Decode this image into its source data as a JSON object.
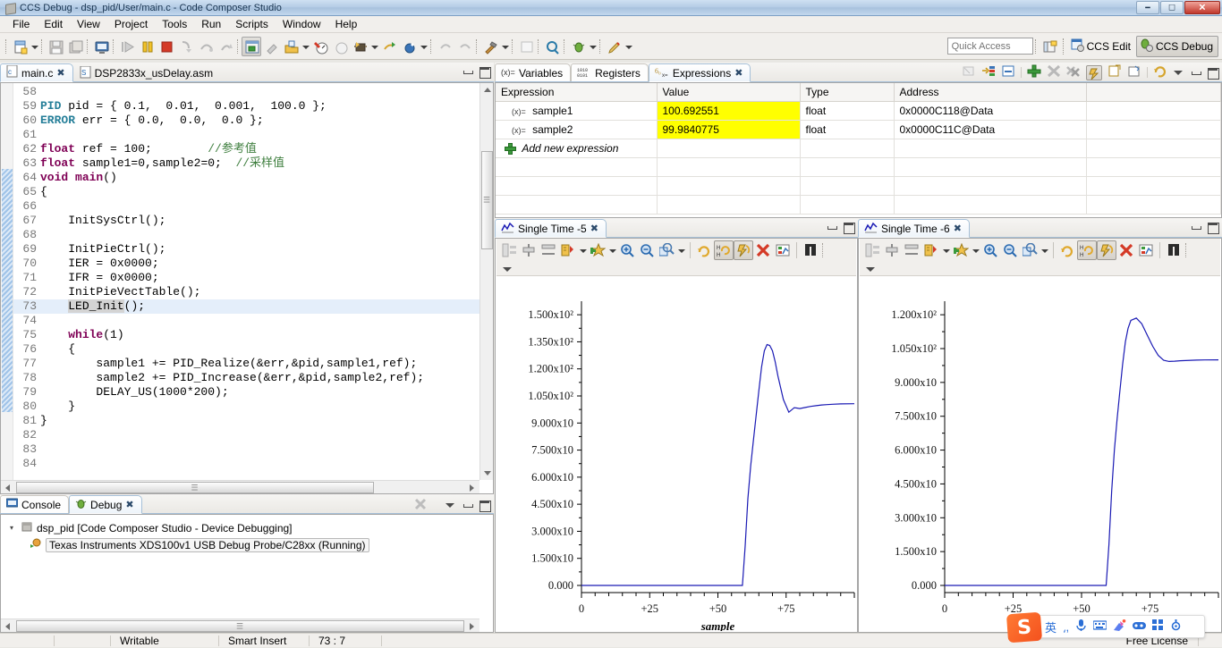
{
  "window": {
    "title": "CCS Debug - dsp_pid/User/main.c - Code Composer Studio",
    "icon": "ccs-app-icon",
    "minimize": "–",
    "restore": "❐",
    "close": "✕"
  },
  "menu": {
    "items": [
      "File",
      "Edit",
      "View",
      "Project",
      "Tools",
      "Run",
      "Scripts",
      "Window",
      "Help"
    ]
  },
  "toolbar": {
    "icons": [
      "new-file-icon",
      "save-icon",
      "save-all-icon",
      "console-icon",
      "resume-icon",
      "suspend-icon",
      "terminate-icon",
      "step-into-icon",
      "step-over-icon",
      "step-return-icon",
      "instruction-stepping-icon",
      "disassembly-icon",
      "load-program-icon",
      "debug-launch-icon",
      "restart-icon",
      "connect-target-icon",
      "run-icon",
      "profile-icon",
      "new-object-icon",
      "undo-icon",
      "redo-icon",
      "build-icon",
      "open-type-icon",
      "search-icon",
      "debug-icon",
      "pin-icon"
    ],
    "quick_access_placeholder": "Quick Access",
    "new_perspective_icon": "open-perspective-icon",
    "perspectives": [
      {
        "label": "CCS Edit",
        "icon": "ccs-edit-icon",
        "active": false
      },
      {
        "label": "CCS Debug",
        "icon": "ccs-debug-icon",
        "active": true
      }
    ]
  },
  "editor": {
    "tabs": [
      {
        "label": "main.c",
        "icon": "c-file-icon",
        "selected": true,
        "closable": true
      },
      {
        "label": "DSP2833x_usDelay.asm",
        "icon": "asm-file-icon",
        "selected": false,
        "closable": false
      }
    ],
    "first_line": 58,
    "highlight_line": 73,
    "lines": [
      {
        "n": 58,
        "text": ""
      },
      {
        "n": 59,
        "html": "<span class='t'>PID</span> pid = { 0.1,  0.01,  0.001,  100.0 };"
      },
      {
        "n": 60,
        "html": "<span class='t'>ERROR</span> err = { 0.0,  0.0,  0.0 };"
      },
      {
        "n": 61,
        "html": ""
      },
      {
        "n": 62,
        "html": "<span class='k'>float</span> ref = 100;        <span class='cm'>//参考值</span>"
      },
      {
        "n": 63,
        "html": "<span class='k'>float</span> sample1=0,sample2=0;  <span class='cm'>//采样值</span>"
      },
      {
        "n": 64,
        "html": "<span class='k'>void</span> <span class='k'>main</span>()"
      },
      {
        "n": 65,
        "html": "{"
      },
      {
        "n": 66,
        "html": ""
      },
      {
        "n": 67,
        "html": "    InitSysCtrl();"
      },
      {
        "n": 68,
        "html": ""
      },
      {
        "n": 69,
        "html": "    InitPieCtrl();"
      },
      {
        "n": 70,
        "html": "    IER = 0x0000;"
      },
      {
        "n": 71,
        "html": "    IFR = 0x0000;"
      },
      {
        "n": 72,
        "html": "    InitPieVectTable();"
      },
      {
        "n": 73,
        "html": "    <span class='sel'>LED_Init</span>();"
      },
      {
        "n": 74,
        "html": ""
      },
      {
        "n": 75,
        "html": "    <span class='k'>while</span>(1)"
      },
      {
        "n": 76,
        "html": "    {"
      },
      {
        "n": 77,
        "html": "        sample1 += PID_Realize(&amp;err,&amp;pid,sample1,ref);"
      },
      {
        "n": 78,
        "html": "        sample2 += PID_Increase(&amp;err,&amp;pid,sample2,ref);"
      },
      {
        "n": 79,
        "html": "        DELAY_US(1000*200);"
      },
      {
        "n": 80,
        "html": "    }"
      },
      {
        "n": 81,
        "html": "}"
      },
      {
        "n": 82,
        "html": ""
      },
      {
        "n": 83,
        "html": ""
      },
      {
        "n": 84,
        "html": ""
      }
    ]
  },
  "debug_view": {
    "tabs": [
      {
        "label": "Console",
        "icon": "console-icon",
        "selected": false
      },
      {
        "label": "Debug",
        "icon": "debug-bug-icon",
        "selected": true,
        "closable": true
      }
    ],
    "toolbar_icons": [
      "remove-all-terminated-icon",
      "view-menu-icon",
      "minimize-icon",
      "maximize-icon"
    ],
    "tree": [
      {
        "level": 0,
        "expanded": true,
        "icon": "launch-config-icon",
        "label": "dsp_pid [Code Composer Studio - Device Debugging]"
      },
      {
        "level": 1,
        "icon": "thread-running-icon",
        "selected": true,
        "label": "Texas Instruments XDS100v1 USB Debug Probe/C28xx (Running)"
      }
    ]
  },
  "expressions": {
    "tabs": [
      {
        "label": "Variables",
        "icon": "variables-icon",
        "selected": false
      },
      {
        "label": "Registers",
        "icon": "registers-icon",
        "selected": false
      },
      {
        "label": "Expressions",
        "icon": "expressions-icon",
        "selected": true,
        "closable": true
      }
    ],
    "toolbar_icons": [
      "cast-to-type-icon",
      "show-type-names-icon",
      "collapse-all-icon",
      "add-expression-icon",
      "remove-icon",
      "remove-all-icon",
      "enable-watch-icon",
      "new-watchpoint-icon",
      "edit-watchpoint-icon",
      "refresh-icon",
      "view-menu-icon",
      "minimize-icon",
      "maximize-icon"
    ],
    "columns": [
      "Expression",
      "Value",
      "Type",
      "Address",
      ""
    ],
    "rows": [
      {
        "expression": "sample1",
        "value": "100.692551",
        "type": "float",
        "address": "0x0000C118@Data",
        "icon": "variable-icon",
        "highlight": true
      },
      {
        "expression": "sample2",
        "value": "99.9840775",
        "type": "float",
        "address": "0x0000C11C@Data",
        "icon": "variable-icon",
        "highlight": true
      }
    ],
    "add_row_label": "Add new expression",
    "highlight_color": "#ffff00"
  },
  "graphs": [
    {
      "tab_label": "Single Time -5",
      "tab_icon": "graph-icon",
      "toolbar_icons": [
        "graph-properties-icon",
        "align-icon",
        "distribute-icon",
        "scale-icon",
        "add-marker-icon",
        "zoom-in-icon",
        "zoom-out-icon",
        "zoom-area-icon",
        "refresh-all-icon",
        "continuous-refresh-h-icon",
        "continuous-refresh-icon",
        "clear-data-icon",
        "export-icon",
        "find-icon"
      ],
      "chart_data": {
        "type": "line",
        "title": "Single Time -5",
        "xlabel": "sample",
        "ylabel": "",
        "series_color": "#1a1ab4",
        "grid": false,
        "legend": "none",
        "ylim": [
          0,
          157.5
        ],
        "xlim": [
          0,
          100
        ],
        "yticks": [
          "0.000",
          "1.500x10",
          "3.000x10",
          "4.500x10",
          "6.000x10",
          "7.500x10",
          "9.000x10",
          "1.050x10²",
          "1.200x10²",
          "1.350x10²",
          "1.500x10²"
        ],
        "ytick_values": [
          0,
          15,
          30,
          45,
          60,
          75,
          90,
          105,
          120,
          135,
          150
        ],
        "xticks": [
          "0",
          "+25",
          "+50",
          "+75"
        ],
        "xtick_values": [
          0,
          25,
          50,
          75
        ],
        "x": [
          0,
          10,
          20,
          30,
          40,
          50,
          55,
          58,
          59,
          60,
          61,
          62,
          63,
          64,
          65,
          66,
          67,
          68,
          69,
          70,
          71,
          72,
          74,
          76,
          78,
          80,
          82,
          84,
          86,
          88,
          90,
          92,
          95,
          100
        ],
        "y": [
          0,
          0,
          0,
          0,
          0,
          0,
          0,
          0,
          0,
          22,
          48,
          66,
          80,
          94,
          108,
          121,
          130,
          133.5,
          133,
          130,
          124,
          116,
          103,
          96,
          98.5,
          98,
          98.6,
          99.2,
          99.6,
          100,
          100.2,
          100.4,
          100.6,
          100.7
        ]
      }
    },
    {
      "tab_label": "Single Time -6",
      "tab_icon": "graph-icon",
      "toolbar_icons": [
        "graph-properties-icon",
        "align-icon",
        "distribute-icon",
        "scale-icon",
        "add-marker-icon",
        "zoom-in-icon",
        "zoom-out-icon",
        "zoom-area-icon",
        "refresh-all-icon",
        "continuous-refresh-h-icon",
        "continuous-refresh-icon",
        "clear-data-icon",
        "export-icon",
        "find-icon"
      ],
      "chart_data": {
        "type": "line",
        "title": "Single Time -6",
        "xlabel": "",
        "ylabel": "",
        "series_color": "#1a1ab4",
        "grid": false,
        "legend": "none",
        "ylim": [
          0,
          126
        ],
        "xlim": [
          0,
          100
        ],
        "yticks": [
          "0.000",
          "1.500x10",
          "3.000x10",
          "4.500x10",
          "6.000x10",
          "7.500x10",
          "9.000x10",
          "1.050x10²",
          "1.200x10²"
        ],
        "ytick_values": [
          0,
          15,
          30,
          45,
          60,
          75,
          90,
          105,
          120
        ],
        "xticks": [
          "0",
          "+25",
          "+50",
          "+75"
        ],
        "xtick_values": [
          0,
          25,
          50,
          75
        ],
        "x": [
          0,
          10,
          20,
          30,
          40,
          50,
          55,
          58,
          59,
          60,
          61,
          62,
          63,
          64,
          65,
          66,
          67,
          68,
          70,
          72,
          74,
          76,
          78,
          80,
          82,
          84,
          86,
          88,
          90,
          92,
          95,
          100
        ],
        "y": [
          0,
          0,
          0,
          0,
          0,
          0,
          0,
          0,
          0,
          18,
          42,
          60,
          74,
          86,
          98,
          108,
          114,
          117.5,
          118.5,
          116,
          111,
          106,
          102,
          99.8,
          99.3,
          99.4,
          99.6,
          99.7,
          99.8,
          99.9,
          99.95,
          100
        ]
      }
    }
  ],
  "statusbar": {
    "writable": "Writable",
    "insert_mode": "Smart Insert",
    "position": "73 : 7",
    "license": "Free License"
  },
  "ime": {
    "logo": "S",
    "items": [
      "英",
      "⸲,",
      "mic-icon",
      "keyboard-icon",
      "paint-icon",
      "toolbox-icon",
      "apps-icon",
      "settings-icon"
    ]
  }
}
